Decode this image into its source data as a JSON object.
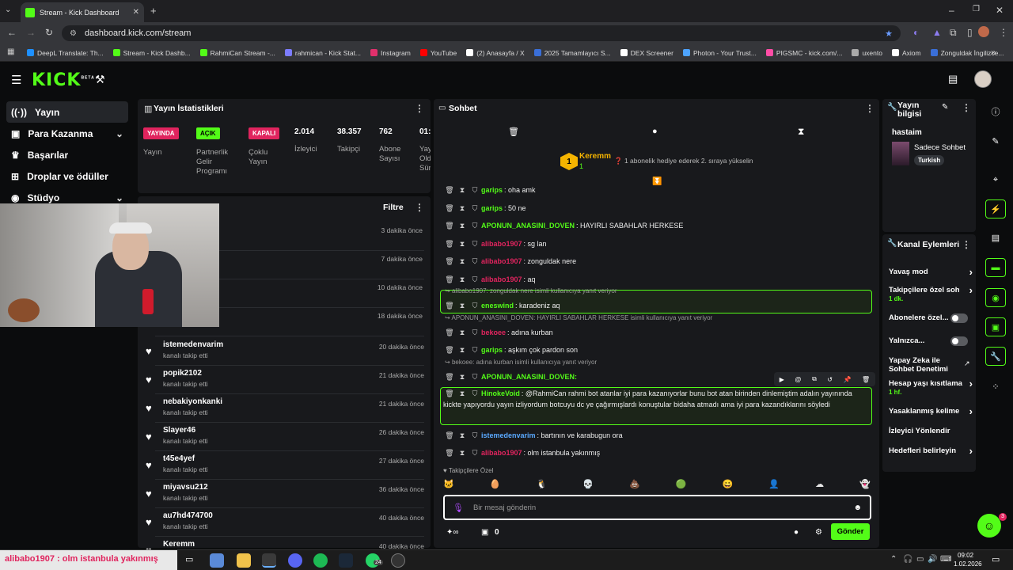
{
  "browser": {
    "tab_title": "Stream - Kick Dashboard",
    "url": "dashboard.kick.com/stream",
    "bookmarks": [
      "DeepL Translate: Th...",
      "Stream - Kick Dashb...",
      "RahmiCan Stream -...",
      "rahmican - Kick Stat...",
      "Instagram",
      "YouTube",
      "(2) Anasayfa / X",
      "2025 Tamamlayıcı S...",
      "DEX Screener",
      "Photon - Your Trust...",
      "PIGSMC - kick.com/...",
      "uxento",
      "Axiom",
      "Zonguldak İngilizce..."
    ],
    "bookmark_colors": [
      "#1e90ff",
      "#53fc18",
      "#53fc18",
      "#7c7cff",
      "#e1306c",
      "#ff0000",
      "#ffffff",
      "#3a6fd8",
      "#ffffff",
      "#4da3ff",
      "#ff4da6",
      "#aaaaaa",
      "#ffffff",
      "#3a6fd8"
    ]
  },
  "kick": {
    "logo": "KICK",
    "beta": "BETA"
  },
  "sidebar": {
    "items": [
      {
        "label": "Yayın",
        "icon": "broadcast-icon"
      },
      {
        "label": "Para Kazanma",
        "icon": "money-icon"
      },
      {
        "label": "Başarılar",
        "icon": "trophy-icon"
      },
      {
        "label": "Droplar ve ödüller",
        "icon": "gift-icon"
      },
      {
        "label": "Stüdyo",
        "icon": "studio-icon"
      }
    ]
  },
  "stats": {
    "title": "Yayın İstatistikleri",
    "badge_live": "YAYINDA",
    "badge_open": "AÇIK",
    "badge_closed": "KAPALI",
    "label_stream": "Yayın",
    "label_partner": "Partnerlik Gelir Programı",
    "label_multi": "Çoklu Yayın",
    "viewers": "2.014",
    "viewers_label": "İzleyici",
    "followers": "38.357",
    "followers_label": "Takipçi",
    "subs": "762",
    "subs_label": "Abone Sayısı",
    "time": "01:",
    "time_label": "Yay Old Sür"
  },
  "follows": {
    "filter": "Filtre",
    "hidden_times": [
      "3 dakika önce",
      "7 dakika önce",
      "10 dakika önce",
      "18 dakika önce"
    ],
    "rows": [
      {
        "name": "istemedenvarim",
        "sub": "kanalı takip etti",
        "time": "20 dakika önce"
      },
      {
        "name": "popik2102",
        "sub": "kanalı takip etti",
        "time": "21 dakika önce"
      },
      {
        "name": "nebakiyonkanki",
        "sub": "kanalı takip etti",
        "time": "21 dakika önce"
      },
      {
        "name": "Slayer46",
        "sub": "kanalı takip etti",
        "time": "26 dakika önce"
      },
      {
        "name": "t45e4yef",
        "sub": "kanalı takip etti",
        "time": "27 dakika önce"
      },
      {
        "name": "miyavsu212",
        "sub": "kanalı takip etti",
        "time": "36 dakika önce"
      },
      {
        "name": "au7hd474700",
        "sub": "kanalı takip etti",
        "time": "40 dakika önce"
      },
      {
        "name": "Keremm",
        "sub": "",
        "time": "40 dakika önce"
      }
    ]
  },
  "chat": {
    "title": "Sohbet",
    "pinned_user": "Keremm",
    "pinned_count": "1",
    "pinned_rank": "1",
    "pinned_text": "1 abonelik hediye ederek 2. sıraya yükselin",
    "messages": [
      {
        "user": "garips",
        "color": "#53fc18",
        "text": ": oha amk"
      },
      {
        "user": "garips",
        "color": "#53fc18",
        "text": ": 50 ne"
      },
      {
        "user": "APONUN_ANASINI_DOVEN",
        "color": "#53fc18",
        "text": ": HAYIRLI SABAHLAR HERKESE"
      },
      {
        "user": "alibabo1907",
        "color": "#e0245e",
        "text": ": sg lan"
      },
      {
        "user": "alibabo1907",
        "color": "#e0245e",
        "text": ": zonguldak nere"
      },
      {
        "user": "alibabo1907",
        "color": "#e0245e",
        "text": ": aq"
      },
      {
        "user": "eneswind",
        "color": "#53fc18",
        "text": ": karadeniz aq",
        "reply": "alibabo1907: zonguldak nere isimli kullanıcıya yanıt veriyor"
      },
      {
        "user": "bekoee",
        "color": "#e0245e",
        "text": ": adına kurban",
        "reply": "APONUN_ANASINI_DOVEN: HAYIRLI SABAHLAR HERKESE  isimli kullanıcıya yanıt veriyor"
      },
      {
        "user": "garips",
        "color": "#53fc18",
        "text": ": aşkım çok pardon son"
      },
      {
        "user": "APONUN_ANASINI_DOVEN:",
        "color": "#53fc18",
        "text": "",
        "reply": "bekoee: adına kurban isimli kullanıcıya yanıt veriyor"
      },
      {
        "user": "HinokeVoid",
        "color": "#53fc18",
        "text": ": @RahmiCan rahmi bot atanlar iyi para kazanıyorlar bunu bot atan birinden dinlemiştim adalın yayınında kickte yapıyordu yayın izliyordum botcuyu dc ye çağırmışlardı konuştular bidaha atmadı ama iyi para kazandıklarını söyledi"
      },
      {
        "user": "istemedenvarim",
        "color": "#5aa9ff",
        "text": ": bartının ve karabugun ora"
      },
      {
        "user": "alibabo1907",
        "color": "#e0245e",
        "text": ": olm istanbula yakınmış"
      }
    ],
    "followers_only": "Takipçilere Özel",
    "input_placeholder": "Bir mesaj gönderin",
    "bottom_count": "0",
    "send": "Gönder"
  },
  "info": {
    "title": "Yayın bilgisi",
    "stream_title": "hastaim",
    "category": "Sadece Sohbet",
    "language": "Turkish"
  },
  "actions": {
    "title": "Kanal Eylemleri",
    "slow": "Yavaş mod",
    "followers_chat": "Takipçilere özel soh",
    "followers_sub": "1 dk.",
    "subs_chat": "Abonelere özel...",
    "only": "Yalnızca...",
    "ai": "Yapay Zeka ile Sohbet Denetimi",
    "account_age": "Hesap yaşı kısıtlama",
    "account_sub": "1 hf.",
    "banned": "Yasaklanmış kelime",
    "redirect": "İzleyici Yönlendir",
    "goals": "Hedefleri belirleyin"
  },
  "taskbar": {
    "ticker": "alibabo1907 : olm istanbula yakınmış",
    "time": "09:02",
    "date": "1.02.2026",
    "badge": "24"
  },
  "notif": "3"
}
